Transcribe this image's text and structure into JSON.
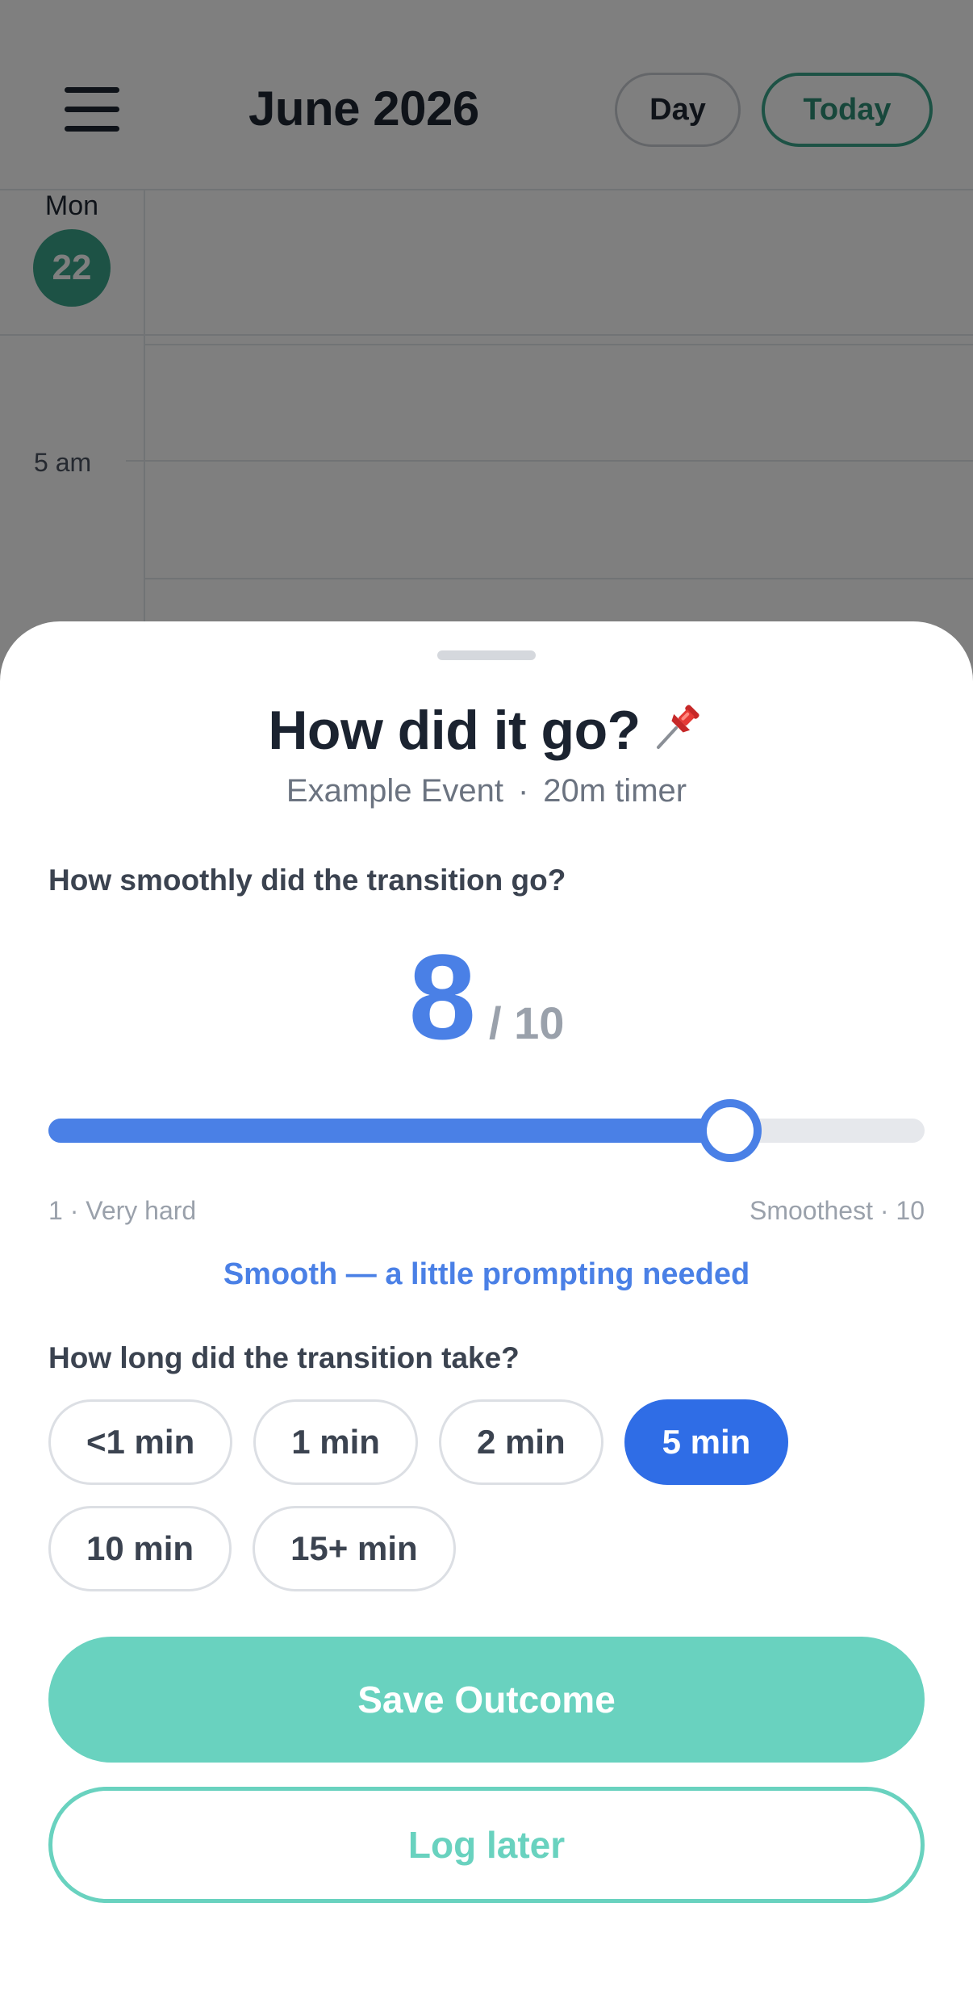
{
  "calendar": {
    "month_title": "June 2026",
    "view_button": "Day",
    "today_button": "Today",
    "day_of_week": "Mon",
    "date_number": "22",
    "hour_label": "5 am"
  },
  "sheet": {
    "title": "How did it go?",
    "title_icon": "pushpin-icon",
    "event_name": "Example Event",
    "separator": "·",
    "timer": "20m timer",
    "smoothness": {
      "question": "How smoothly did the transition go?",
      "value": 8,
      "value_text": "8",
      "max_text": "/ 10",
      "min": 1,
      "max": 10,
      "min_label": "1 · Very hard",
      "max_label": "Smoothest · 10",
      "hint": "Smooth — a little prompting needed"
    },
    "duration": {
      "question": "How long did the transition take?",
      "options": [
        "<1 min",
        "1 min",
        "2 min",
        "5 min",
        "10 min",
        "15+ min"
      ],
      "selected": "5 min"
    },
    "save_label": "Save Outcome",
    "later_label": "Log later"
  },
  "colors": {
    "accent_blue": "#4a80e6",
    "selected_chip": "#2f6de6",
    "teal": "#69d2bf",
    "calendar_teal": "#3aa58a"
  }
}
